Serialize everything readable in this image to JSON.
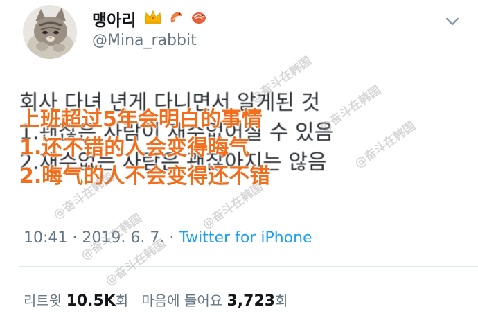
{
  "header": {
    "display_name": "맹아리",
    "handle": "@Mina_rabbit",
    "name_icons": [
      "crown-icon",
      "shrimp-icon",
      "shrimp-icon"
    ],
    "caret_icon": "chevron-down-icon"
  },
  "tweet": {
    "lines": [
      "회사 다녀 년게 다니면서 알게된 것",
      "1.괜찮은 사람이 재수없어질 수 있음",
      "2.재수없는 사람은 괜찮아지는 않음"
    ]
  },
  "overlay": {
    "lines": [
      "上班超过5年会明白的事情",
      "1.还不错的人会变得晦气",
      "2.晦气的人不会变得还不错"
    ],
    "color": "#f26d1c"
  },
  "meta": {
    "time": "10:41",
    "separator": "·",
    "date": "2019. 6. 7.",
    "source": "Twitter for iPhone"
  },
  "stats": {
    "retweets_label": "리트윗",
    "retweets_count": "10.5K",
    "retweets_suffix": "회",
    "likes_label": "마음에 들어요",
    "likes_count": "3,723",
    "likes_suffix": "회"
  },
  "watermark": "@奋斗在韩国"
}
